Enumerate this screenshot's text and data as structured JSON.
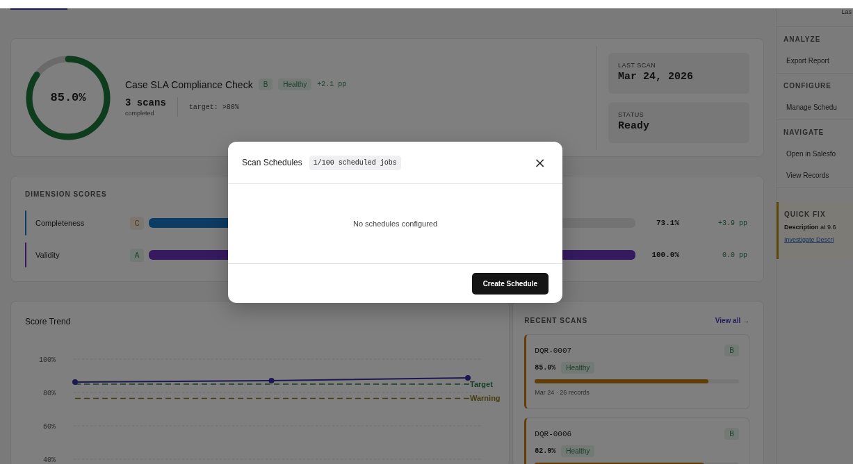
{
  "summary": {
    "level": 0.85,
    "score": "85.0%",
    "title": "Case SLA Compliance Check",
    "grade": "B",
    "status": "Healthy",
    "delta": "+2.1 pp",
    "scans": "3 scans",
    "scans_caption": "completed",
    "target": "target: >80%",
    "stats": [
      {
        "label": "LAST SCAN",
        "value": "Mar 24, 2026"
      },
      {
        "label": "STATUS",
        "value": "Ready"
      }
    ]
  },
  "dimensions": {
    "title": "DIMENSION SCORES",
    "rows": [
      {
        "name": "Completeness",
        "grade": "C",
        "kind": "warning",
        "color": "#0c3b64",
        "level": 0.731,
        "value": "73.1%",
        "delta": "+3.9 pp"
      },
      {
        "name": "Validity",
        "grade": "A",
        "kind": "good",
        "color": "#351a60",
        "level": 1.0,
        "value": "100.0%",
        "delta": "0.0 pp"
      }
    ]
  },
  "trend": {
    "title": "Score Trend",
    "chart_data": {
      "type": "line",
      "ylim": [
        40,
        100
      ],
      "yticks": [
        {
          "value": 40,
          "label": "40%"
        },
        {
          "value": 60,
          "label": "60%"
        },
        {
          "value": 80,
          "label": "80%"
        },
        {
          "value": 100,
          "label": "100%"
        }
      ],
      "series": [
        {
          "color": "#1d1753",
          "marker": "circle",
          "values": [
            86.2,
            87.1,
            88.7
          ]
        }
      ],
      "ref_lines": [
        {
          "axis": "y",
          "value": 85,
          "label": "Target",
          "color": "#173e27"
        },
        {
          "axis": "y",
          "value": 76.5,
          "label": "Warning",
          "color": "#453d0e"
        }
      ]
    }
  },
  "recent_scans": {
    "title": "RECENT SCANS",
    "link": "View all →",
    "items": [
      {
        "id": "DQR-0007",
        "grade": "B",
        "score": "85.0%",
        "status": "Healthy",
        "level": 0.85,
        "meta": "Mar 24 · 26 records"
      },
      {
        "id": "DQR-0006",
        "grade": "B",
        "score": "82.9%",
        "status": "Healthy",
        "level": 0.829
      }
    ]
  },
  "sidebar": {
    "top_text": "Las",
    "sections": [
      {
        "title": "ANALYZE",
        "items": [
          "Export Report"
        ]
      },
      {
        "title": "CONFIGURE",
        "items": [
          "Manage Schedu"
        ]
      },
      {
        "title": "NAVIGATE",
        "items": [
          "Open in Salesfo",
          "View Records"
        ]
      }
    ],
    "quick_fix": {
      "title": "QUICK FIX",
      "text": "**Description** at 9.6",
      "link": "Investigate Descri"
    }
  },
  "modal": {
    "title": "Scan Schedules",
    "count": "1/100 scheduled jobs",
    "close": "×",
    "empty": "No schedules configured",
    "button": "Create Schedule"
  }
}
